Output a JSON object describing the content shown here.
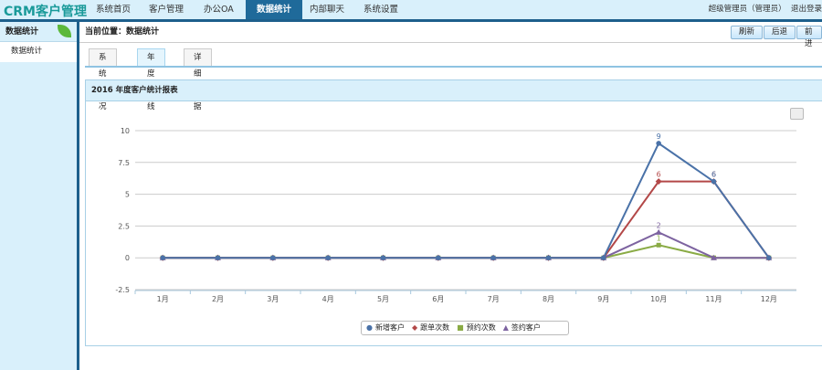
{
  "header": {
    "logo": "CRM客户管理",
    "nav": [
      "系统首页",
      "客户管理",
      "办公OA",
      "数据统计",
      "内部聊天",
      "系统设置"
    ],
    "active_nav": "数据统计",
    "user": "超级管理员（管理员）",
    "logout": "退出登录"
  },
  "sidebar": {
    "title": "数据统计",
    "items": [
      "数据统计"
    ]
  },
  "breadcrumb": "当前位置：数据统计",
  "toolbar": {
    "refresh": "刷新",
    "back": "后退",
    "forward": "前进"
  },
  "tabs": [
    {
      "label": "系统概况"
    },
    {
      "label": "年度曲线",
      "active": true
    },
    {
      "label": "详细数据"
    }
  ],
  "panel_title": "2016 年度客户统计报表",
  "chart_data": {
    "type": "line",
    "categories": [
      "1月",
      "2月",
      "3月",
      "4月",
      "5月",
      "6月",
      "7月",
      "8月",
      "9月",
      "10月",
      "11月",
      "12月"
    ],
    "ylim": [
      -2.5,
      10
    ],
    "yticks": [
      "10",
      "7.5",
      "5",
      "2.5",
      "0",
      "-2.5"
    ],
    "grid": true,
    "legend": "bottom",
    "series": [
      {
        "name": "新增客户",
        "color": "#4a72a8",
        "marker": "circle",
        "values": [
          0,
          0,
          0,
          0,
          0,
          0,
          0,
          0,
          0,
          9,
          6,
          0
        ]
      },
      {
        "name": "跟单次数",
        "color": "#b34848",
        "marker": "diamond",
        "values": [
          0,
          0,
          0,
          0,
          0,
          0,
          0,
          0,
          0,
          6,
          6,
          0
        ]
      },
      {
        "name": "预约次数",
        "color": "#8aab45",
        "marker": "square",
        "values": [
          0,
          0,
          0,
          0,
          0,
          0,
          0,
          0,
          0,
          1,
          0,
          0
        ]
      },
      {
        "name": "签约客户",
        "color": "#7d63a0",
        "marker": "triangle",
        "values": [
          0,
          0,
          0,
          0,
          0,
          0,
          0,
          0,
          0,
          2,
          0,
          0
        ]
      }
    ]
  }
}
